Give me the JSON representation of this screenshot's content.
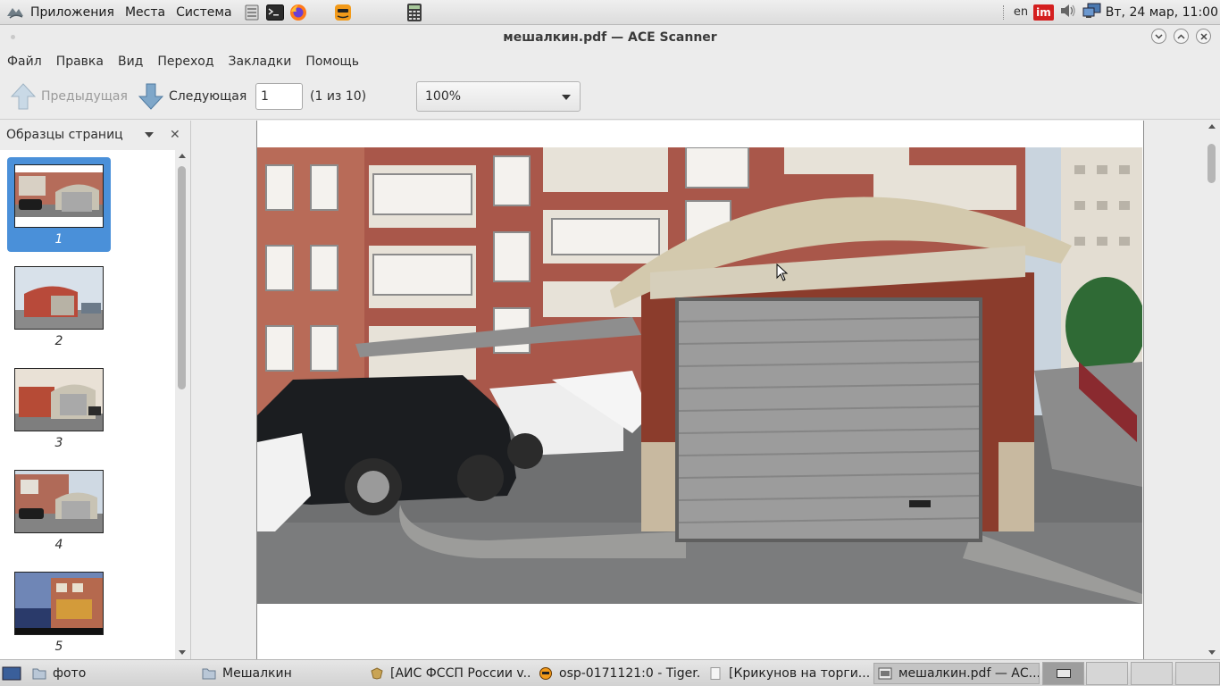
{
  "top_panel": {
    "menus": [
      "Приложения",
      "Места",
      "Система"
    ],
    "lang": "en",
    "im_badge": "im",
    "clock": "Вт, 24 мар, 11:00"
  },
  "window": {
    "title": "мешалкин.pdf — ACE Scanner"
  },
  "menubar": [
    "Файл",
    "Правка",
    "Вид",
    "Переход",
    "Закладки",
    "Помощь"
  ],
  "toolbar": {
    "prev_label": "Предыдущая",
    "next_label": "Следующая",
    "page_value": "1",
    "page_count": "(1 из 10)",
    "zoom": "100%"
  },
  "sidebar": {
    "title": "Образцы страниц",
    "close_glyph": "✕",
    "thumbnails": [
      "1",
      "2",
      "3",
      "4",
      "5"
    ],
    "selected_index": 0
  },
  "taskbar": {
    "tasks": [
      {
        "label": "фото",
        "icon": "folder-icon"
      },
      {
        "label": "Мешалкин",
        "icon": "folder-icon"
      },
      {
        "label": "[АИС ФССП России v...",
        "icon": "emblem-icon"
      },
      {
        "label": "osp-0171121:0 - Tiger...",
        "icon": "vnc-icon"
      },
      {
        "label": "[Крикунов на торги....",
        "icon": "document-icon"
      },
      {
        "label": "мешалкин.pdf — АС...",
        "icon": "pdf-viewer-icon",
        "active": true
      }
    ]
  },
  "colors": {
    "selection": "#4a90d9",
    "panel": "#ececec",
    "im_red": "#d41f1f"
  }
}
